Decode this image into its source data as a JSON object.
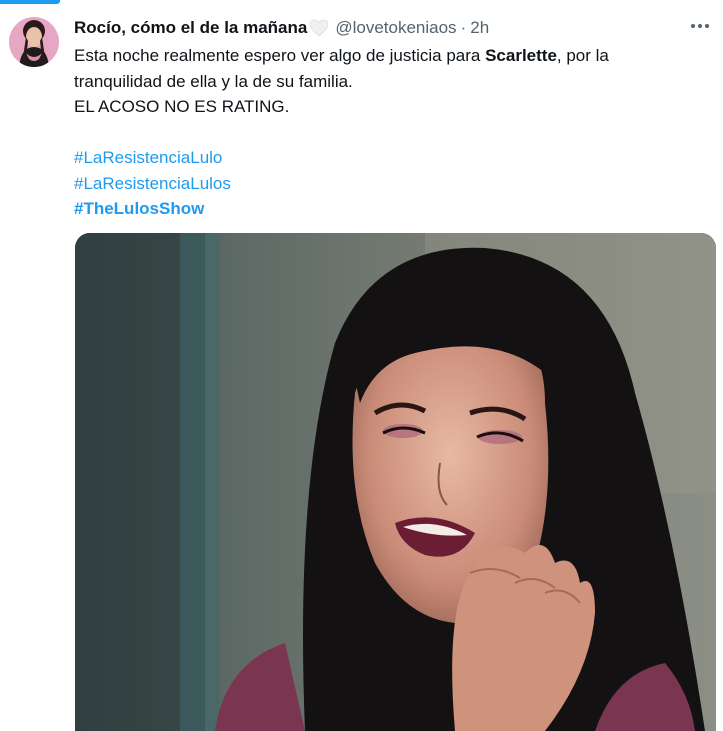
{
  "tweet": {
    "author": {
      "display_name": "Rocío, cómo el de la mañana",
      "name_emoji": "white-heart-icon",
      "handle": "@lovetokeniaos",
      "separator": "·",
      "time": "2h"
    },
    "body": {
      "line1_prefix": "Esta noche realmente espero ver algo de justicia para ",
      "line1_bold": "Scarlette",
      "line1_suffix": ", por la",
      "line2": "tranquilidad de ella y la de su familia.",
      "line3": "EL ACOSO NO ES RATING."
    },
    "hashtags": [
      {
        "text": "#LaResistenciaLulo"
      },
      {
        "text": "#LaResistenciaLulos"
      },
      {
        "text": "#TheLulosShow"
      }
    ],
    "media": {
      "description_icon": "photo-woman-smiling"
    }
  },
  "colors": {
    "accent": "#1d9bf0",
    "text": "#0f1419",
    "secondary": "#536471"
  }
}
